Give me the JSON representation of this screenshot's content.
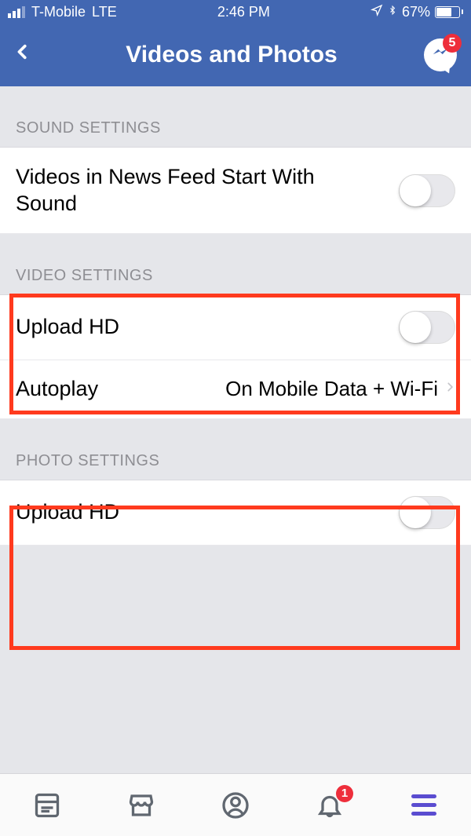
{
  "status": {
    "carrier": "T-Mobile",
    "network": "LTE",
    "time": "2:46 PM",
    "battery_pct": "67%"
  },
  "nav": {
    "title": "Videos and Photos",
    "messenger_badge": "5"
  },
  "sections": {
    "sound": {
      "header": "SOUND SETTINGS",
      "row_label": "Videos in News Feed Start With Sound"
    },
    "video": {
      "header": "VIDEO SETTINGS",
      "upload_label": "Upload HD",
      "autoplay_label": "Autoplay",
      "autoplay_value": "On Mobile Data + Wi-Fi"
    },
    "photo": {
      "header": "PHOTO SETTINGS",
      "upload_label": "Upload HD"
    }
  },
  "tabbar": {
    "notifications_badge": "1"
  }
}
